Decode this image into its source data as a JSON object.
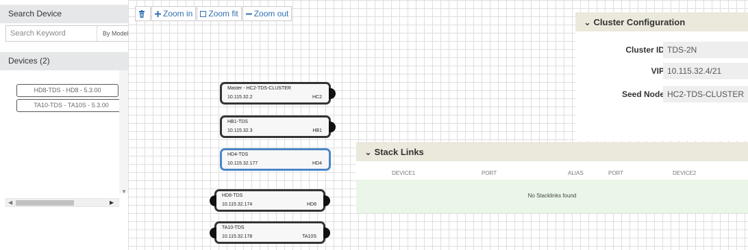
{
  "search_panel": {
    "title": "Search Device",
    "search_placeholder": "Search Keyword",
    "search_by": "By Model"
  },
  "devices_panel": {
    "title": "Devices (2)",
    "items": [
      {
        "label": "HD8-TDS - HD8 - 5.3.00"
      },
      {
        "label": "TA10-TDS - TA10S - 5.3.00"
      }
    ]
  },
  "toolbar": {
    "zoom_in": "Zoom in",
    "zoom_fit": "Zoom fit",
    "zoom_out": "Zoom out"
  },
  "nodes": [
    {
      "name": "Master - HC2-TDS-CLUSTER",
      "ip": "10.115.32.2",
      "model": "HC2",
      "selected": false
    },
    {
      "name": "HB1-TDS",
      "ip": "10.115.32.3",
      "model": "HB1",
      "selected": false
    },
    {
      "name": "HD4-TDS",
      "ip": "10.115.32.177",
      "model": "HD4",
      "selected": true
    },
    {
      "name": "HD8-TDS",
      "ip": "10.115.32.174",
      "model": "HD8",
      "selected": false
    },
    {
      "name": "TA10-TDS",
      "ip": "10.115.32.178",
      "model": "TA10S",
      "selected": false
    }
  ],
  "cluster_config": {
    "title": "Cluster Configuration",
    "cluster_id_label": "Cluster ID",
    "cluster_id_value": "TDS-2N",
    "vip_label": "VIP",
    "vip_value": "10.115.32.4/21",
    "seed_node_label": "Seed Node",
    "seed_node_value": "HC2-TDS-CLUSTER"
  },
  "stack_links": {
    "title": "Stack Links",
    "columns": [
      "DEVICE1",
      "PORT",
      "ALIAS",
      "PORT",
      "DEVICE2"
    ],
    "empty_message": "No Stacklinks found"
  },
  "colors": {
    "accent": "#2f6fb0",
    "selected_border": "#4a86c5",
    "panel_header": "#ebe8dc",
    "empty_row": "#eaf6e7"
  }
}
